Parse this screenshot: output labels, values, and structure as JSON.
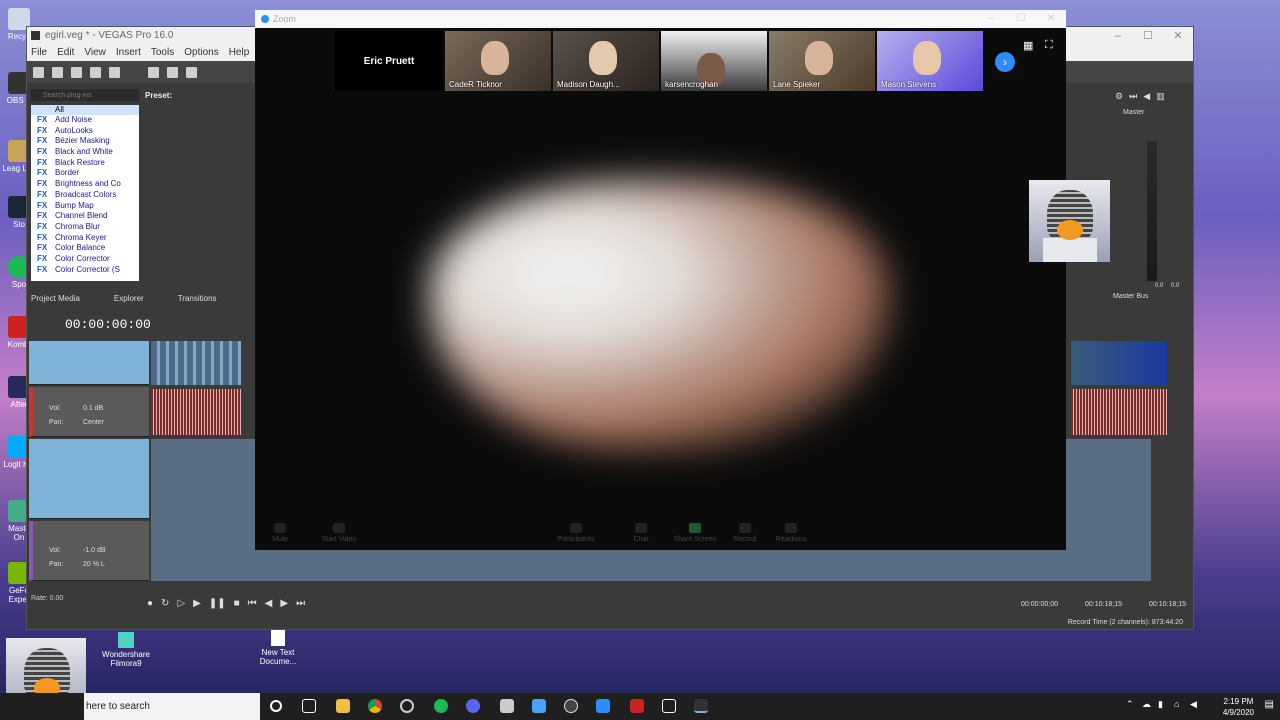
{
  "vegas": {
    "title": "egirl.veg * - VEGAS Pro 16.0",
    "menu": [
      "File",
      "Edit",
      "View",
      "Insert",
      "Tools",
      "Options",
      "Help"
    ],
    "search_placeholder": "Search plug-ins",
    "preset_label": "Preset:",
    "fx_root": "All",
    "fx_items": [
      "Add Noise",
      "AutoLooks",
      "Bézier Masking",
      "Black and White",
      "Black Restore",
      "Border",
      "Brightness and Co",
      "Broadcast Colors",
      "Bump Map",
      "Channel Blend",
      "Chroma Blur",
      "Chroma Keyer",
      "Color Balance",
      "Color Corrector",
      "Color Corrector (S"
    ],
    "tabs": [
      "Project Media",
      "Explorer",
      "Transitions"
    ],
    "timecode": "00:00:00:00",
    "track2": {
      "vol_label": "Vol:",
      "vol_value": "0.1 dB",
      "pan_label": "Pan:",
      "pan_value": "Center"
    },
    "track4": {
      "vol_label": "Vol:",
      "vol_value": "-1.0 dB",
      "pan_label": "Pan:",
      "pan_value": "20 % L"
    },
    "rate": "Rate: 0.00",
    "tc_start": "00:00:00;00",
    "tc_end": "00:10:18;15",
    "tc_length": "00:10:18;15",
    "record_time": "Record Time (2 channels): 873:44:20",
    "master_label": "Master",
    "master_bus": "Master Bus",
    "meter_values": [
      "0.0",
      "0.0"
    ]
  },
  "zoom": {
    "title": "Zoom",
    "host_name": "Eric Pruett",
    "participants": [
      "CadeR Ticknor",
      "Madison Daugh...",
      "karsencroghan",
      "Lane Spieker",
      "Mason Stevens"
    ],
    "controls": [
      "Mute",
      "Start Video",
      "Participants",
      "Chat",
      "Share Screen",
      "Record",
      "Reactions"
    ],
    "accent": "#2d8cff"
  },
  "desktop": {
    "icons": [
      "Recyc",
      "OBS S",
      "Leag Leg",
      "Sto",
      "Spo",
      "Kombi",
      "After",
      "Logit HU",
      "Maste On",
      "GeFo Exper"
    ],
    "files": [
      "Wondershare Filmora9",
      "New Text Docume..."
    ]
  },
  "taskbar": {
    "search_text": "here to search",
    "time": "2:19 PM",
    "date": "4/9/2020"
  }
}
